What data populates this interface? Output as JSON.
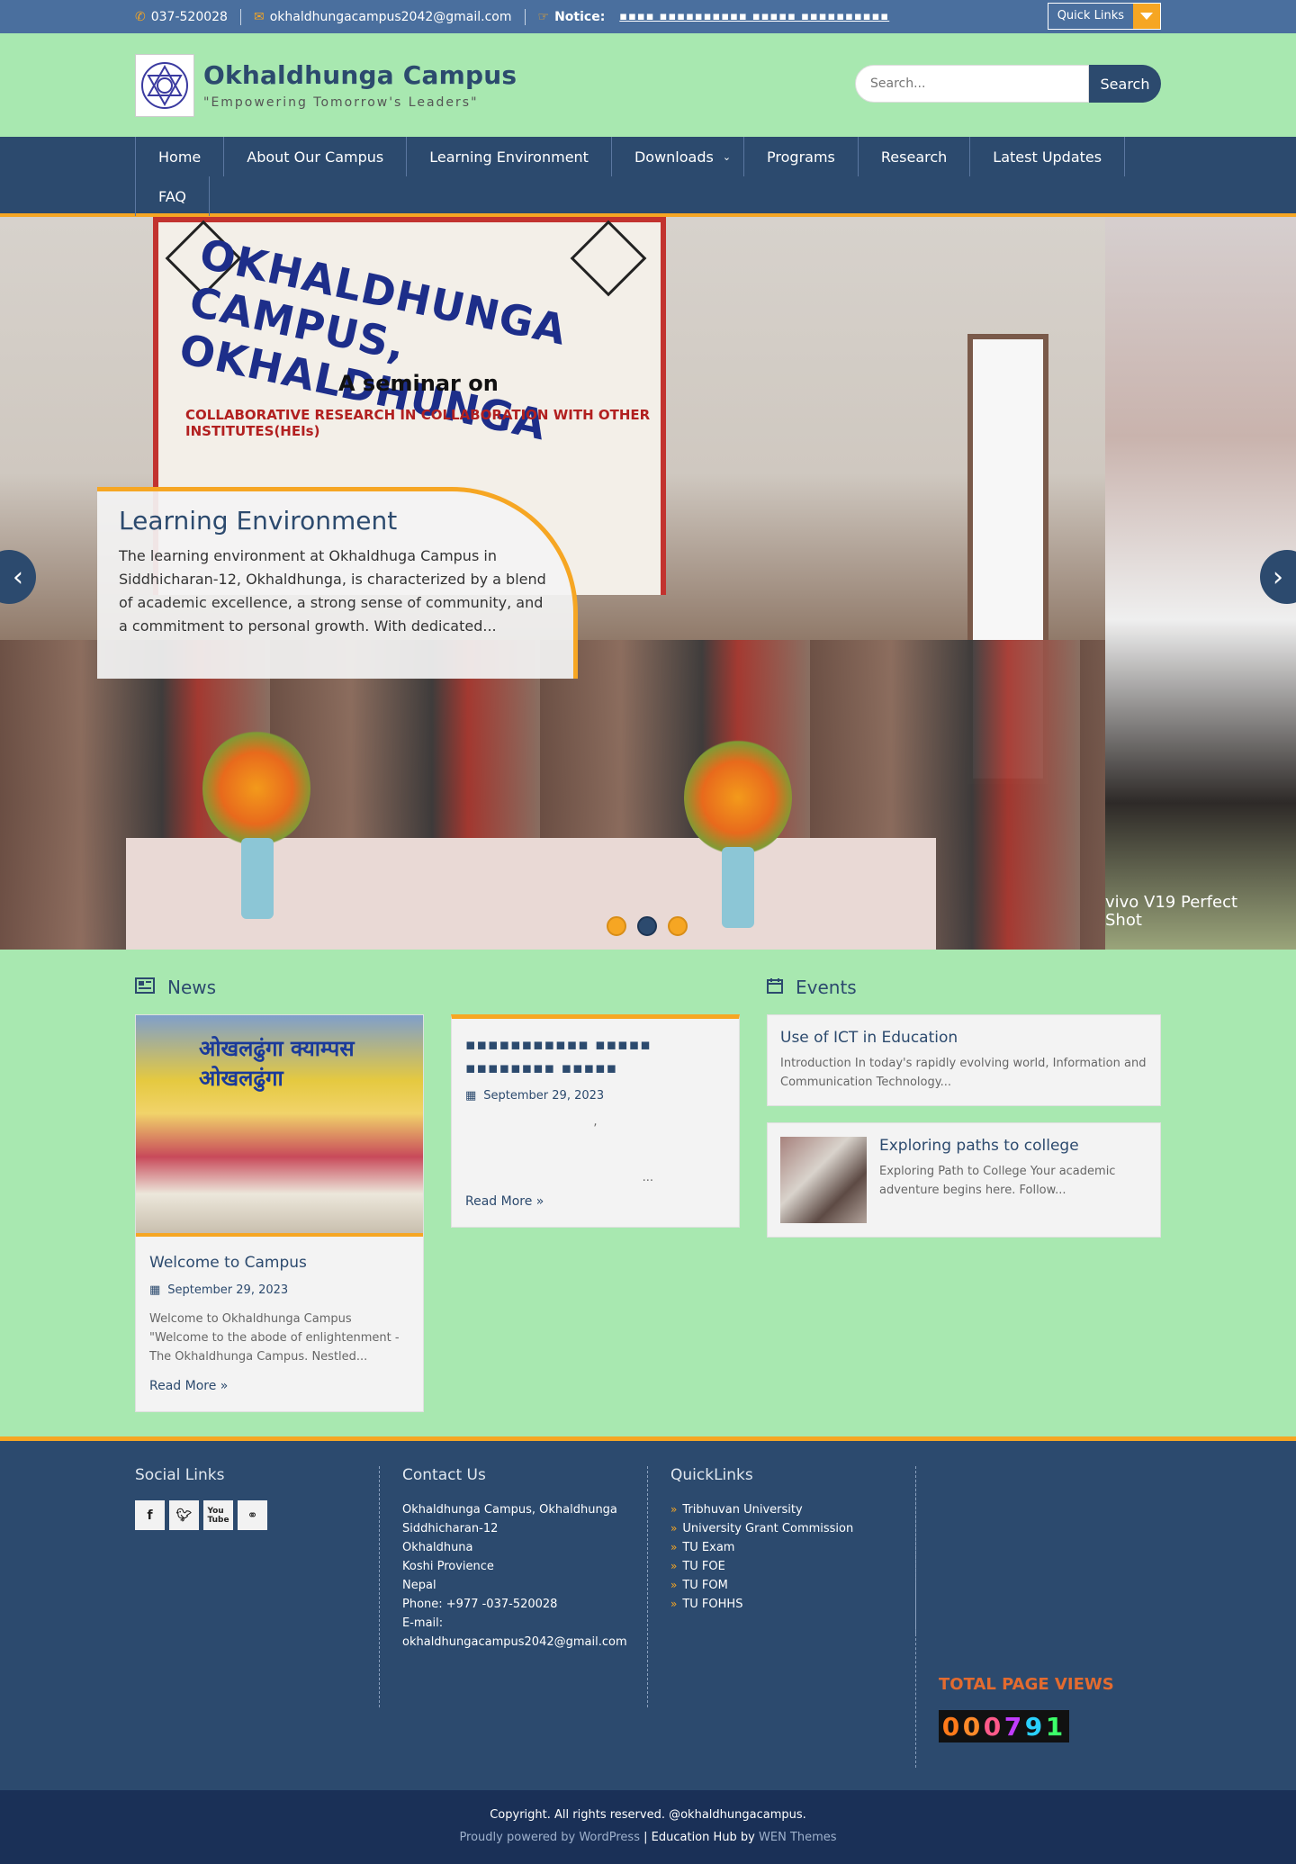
{
  "topbar": {
    "phone": "037-520028",
    "email": "okhaldhungacampus2042@gmail.com",
    "notice_label": "Notice:",
    "notice_text": "▪▪▪▪ ▪▪▪▪▪▪▪▪▪▪ ▪▪▪▪▪ ▪▪▪▪▪▪▪▪▪▪",
    "quick_links": "Quick Links"
  },
  "header": {
    "site_title": "Okhaldhunga Campus",
    "tagline": "\"Empowering Tomorrow's Leaders\"",
    "search_placeholder": "Search...",
    "search_button": "Search"
  },
  "nav": {
    "items": [
      "Home",
      "About Our Campus",
      "Learning Environment",
      "Downloads",
      "Programs",
      "Research",
      "Latest Updates",
      "FAQ"
    ]
  },
  "slider": {
    "banner_title": "OKHALDHUNGA CAMPUS, OKHALDHUNGA",
    "banner_sub": "A seminar on",
    "banner_sub2": "COLLABORATIVE RESEARCH IN COLLABORATION WITH OTHER INSTITUTES(HEIs)",
    "caption_title": "Learning Environment",
    "caption_text": "The learning environment at Okhaldhuga Campus in Siddhicharan-12, Okhaldhunga, is characterized by a blend of academic excellence, a strong sense of community, and a commitment to personal growth. With dedicated...",
    "watermark": "vivo V19 Perfect Shot"
  },
  "news": {
    "title": "News",
    "cards": [
      {
        "title": "Welcome to Campus",
        "date": "September 29, 2023",
        "excerpt": "Welcome to Okhaldhunga Campus \"Welcome to the abode of enlightenment - The Okhaldhunga Campus. Nestled...",
        "read_more": "Read More »",
        "image_text": "ओखलढुंगा क्याम्पस ओखलढुंगा"
      },
      {
        "title": "▪▪▪▪▪▪▪▪▪▪▪ ▪▪▪▪▪ ▪▪▪▪▪▪▪▪ ▪▪▪▪▪",
        "date": "September 29, 2023",
        "ghost1": ",",
        "ghost2": "...",
        "read_more": "Read More »"
      }
    ]
  },
  "events": {
    "title": "Events",
    "items": [
      {
        "title": "Use of ICT in Education",
        "text": "Introduction In today's rapidly evolving world, Information and Communication Technology..."
      },
      {
        "title": "Exploring paths to college",
        "text": "Exploring Path to College Your academic adventure begins here. Follow..."
      }
    ]
  },
  "footer": {
    "social_title": "Social Links",
    "contact_title": "Contact Us",
    "contact_lines": [
      "Okhaldhunga Campus, Okhaldhunga",
      "Siddhicharan-12",
      "Okhaldhuna",
      "Koshi Provience",
      "Nepal",
      "Phone: +977 -037-520028",
      "E-mail:",
      "okhaldhungacampus2042@gmail.com"
    ],
    "quicklinks_title": "QuickLinks",
    "quicklinks": [
      "Tribhuvan University",
      "University Grant Commission",
      "TU Exam",
      "TU FOE",
      "TU FOM",
      "TU FOHHS"
    ],
    "page_views_title": "TOTAL PAGE VIEWS",
    "counter_digits": [
      "0",
      "0",
      "0",
      "7",
      "9",
      "1"
    ],
    "counter_colors": [
      "#ff7a1a",
      "#ff8a2a",
      "#ff5a8a",
      "#c23cff",
      "#2ad1ff",
      "#3cff6a"
    ]
  },
  "copyright": {
    "line1": "Copyright. All rights reserved. @okhaldhungacampus.",
    "powered": "Proudly powered by WordPress",
    "sep": "|",
    "theme": "Education Hub",
    "by": "by",
    "author": "WEN Themes"
  }
}
